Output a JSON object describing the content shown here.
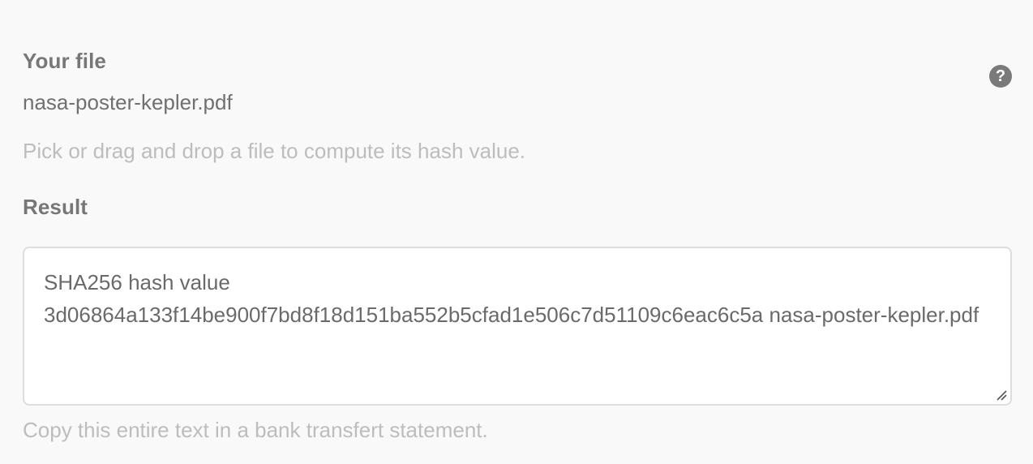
{
  "file": {
    "label": "Your file",
    "name": "nasa-poster-kepler.pdf",
    "hint": "Pick or drag and drop a file to compute its hash value."
  },
  "help": {
    "icon": "question-icon",
    "glyph": "?"
  },
  "result": {
    "label": "Result",
    "title": "SHA256 hash value",
    "hash_line": "3d06864a133f14be900f7bd8f18d151ba552b5cfad1e506c7d51109c6eac6c5a nasa-poster-kepler.pdf",
    "hint": "Copy this entire text in a bank transfert statement."
  },
  "colors": {
    "background": "#f9f9f9",
    "label": "#777777",
    "hint": "#bdbdbd",
    "box_border": "#dddddd"
  }
}
